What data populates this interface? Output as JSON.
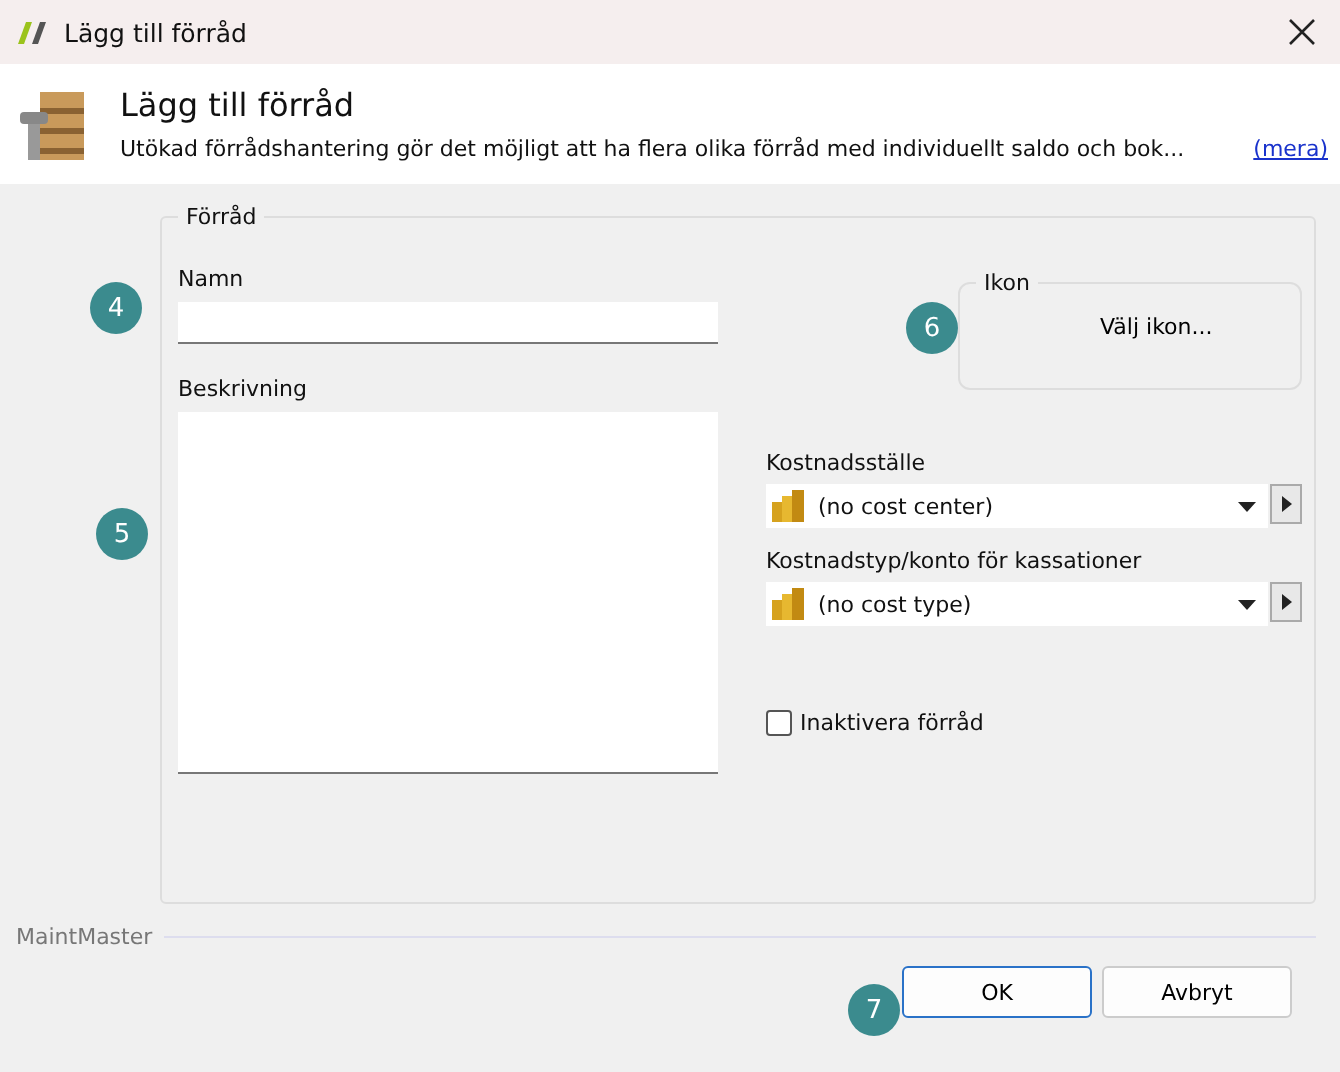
{
  "window": {
    "title": "Lägg till förråd"
  },
  "header": {
    "title": "Lägg till förråd",
    "description": "Utökad förrådshantering gör det möjligt att ha flera olika förråd med individuellt saldo och bok...",
    "link": "(mera)"
  },
  "group": {
    "title": "Förråd"
  },
  "name_field": {
    "label": "Namn"
  },
  "description_field": {
    "label": "Beskrivning"
  },
  "icon_group": {
    "title": "Ikon",
    "button": "Välj ikon..."
  },
  "dropdowns": [
    {
      "label": "Kostnadsställe",
      "value": "(no cost center)"
    },
    {
      "label": "Kostnadstyp/konto för kassationer",
      "value": "(no cost type)"
    }
  ],
  "inactive": {
    "label": "Inaktivera förråd",
    "checked": false
  },
  "footer": {
    "brand": "MaintMaster",
    "buttons": [
      {
        "label": "OK",
        "default": true
      },
      {
        "label": "Avbryt",
        "default": false
      }
    ]
  },
  "annotations": [
    "4",
    "5",
    "6",
    "7"
  ]
}
